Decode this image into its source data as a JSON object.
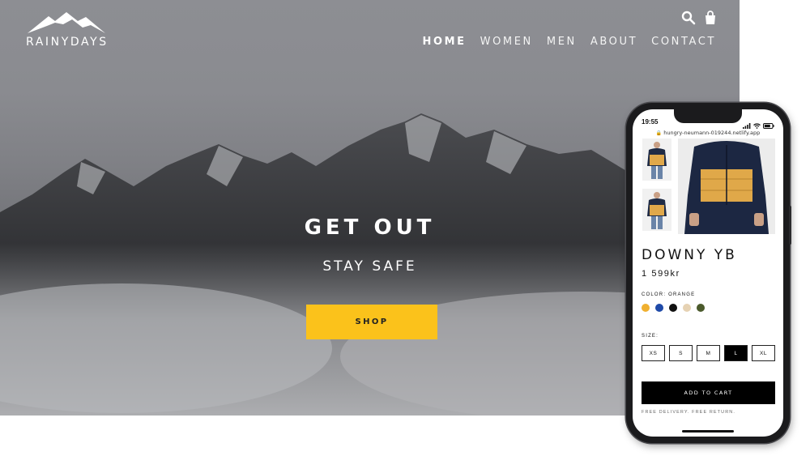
{
  "site": {
    "logo_text": "RAINYDAYS",
    "nav": [
      {
        "label": "HOME",
        "active": true
      },
      {
        "label": "WOMEN",
        "active": false
      },
      {
        "label": "MEN",
        "active": false
      },
      {
        "label": "ABOUT",
        "active": false
      },
      {
        "label": "CONTACT",
        "active": false
      }
    ],
    "icons": [
      "search-icon",
      "shopping-bag-icon"
    ]
  },
  "hero": {
    "title": "GET OUT",
    "subtitle": "STAY SAFE",
    "cta_label": "SHOP",
    "cta_color": "#fbc21b"
  },
  "phone": {
    "status_time": "19:55",
    "url": "hungry-neumann-019244.netlify.app",
    "product": {
      "name": "DOWNY YB",
      "price": "1 599kr",
      "color_label": "COLOR: ORANGE",
      "colors": [
        "#f0b030",
        "#1f4aa8",
        "#111111",
        "#e6d2b3",
        "#4b5a2c"
      ],
      "size_label": "SIZE:",
      "sizes": [
        "XS",
        "S",
        "M",
        "L",
        "XL"
      ],
      "selected_size": "L",
      "add_to_cart": "ADD TO CART",
      "delivery_note": "FREE DELIVERY. FREE RETURN."
    }
  }
}
